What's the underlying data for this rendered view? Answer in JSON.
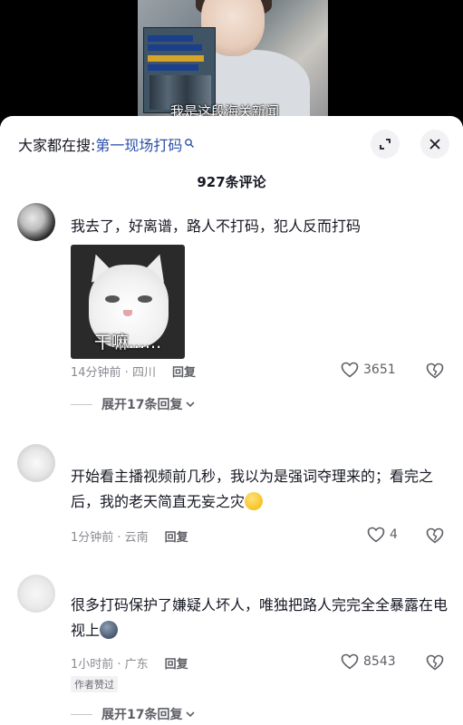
{
  "video": {
    "caption": "我是这段海关新闻"
  },
  "header": {
    "search_prefix": "大家都在搜:",
    "search_term": "第一现场打码",
    "comment_count": "927条评论"
  },
  "comments": [
    {
      "text": "我去了，好离谱，路人不打码，犯人反而打码",
      "sticker_text": "干嘛......",
      "time_location": "14分钟前 · 四川",
      "reply_label": "回复",
      "likes": "3651",
      "expand_label": "展开17条回复"
    },
    {
      "text": "开始看主播视频前几秒，我以为是强词夺理来的；看完之后，我的老天简直无妄之灾",
      "time_location": "1分钟前 · 云南",
      "reply_label": "回复",
      "likes": "4"
    },
    {
      "text": "很多打码保护了嫌疑人坏人，唯独把路人完完全全暴露在电视上",
      "time_location": "1小时前 · 广东",
      "reply_label": "回复",
      "likes": "8543",
      "badge": "作者赞过",
      "expand_label": "展开17条回复"
    }
  ],
  "colors": {
    "search_term": "#2b4fa8",
    "text_primary": "#161823",
    "text_secondary": "#8a8b91"
  },
  "icons": [
    "search-icon",
    "expand-icon",
    "close-icon",
    "heart-icon",
    "dislike-heart-icon",
    "chevron-down-icon"
  ]
}
